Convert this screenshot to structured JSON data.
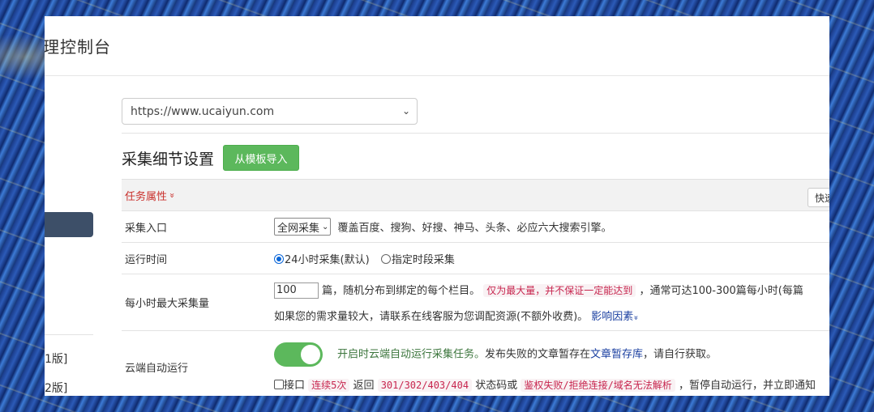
{
  "header": {
    "title": "理控制台"
  },
  "sidebar": {
    "items": [
      {
        "label": "1版]"
      },
      {
        "label": "2版]"
      }
    ]
  },
  "site_select": {
    "value": "https://www.ucaiyun.com"
  },
  "section": {
    "title": "采集细节设置",
    "import_button": "从模板导入"
  },
  "table": {
    "header_label": "任务属性",
    "header_caret": "»",
    "quick_button": "快速",
    "entry": {
      "label": "采集入口",
      "select_value": "全网采集",
      "desc": "覆盖百度、搜狗、好搜、神马、头条、必应六大搜索引擎。"
    },
    "runtime": {
      "label": "运行时间",
      "option1": "24小时采集(默认)",
      "option2": "指定时段采集"
    },
    "max_per_hour": {
      "label": "每小时最大采集量",
      "input_value": "100",
      "text1": "篇，随机分布到绑定的每个栏目。",
      "highlight": "仅为最大量，并不保证一定能达到",
      "text2": "，通常可达100-300篇每小时(每篇",
      "line2": "如果您的需求量较大，请联系在线客服为您调配资源(不额外收费)。",
      "link": "影响因素",
      "link_caret": "»"
    },
    "cloud_run": {
      "label": "云端自动运行",
      "toggle_text": "开启时云端自动运行采集任务。",
      "text_mid": "发布失败的文章暂存在",
      "link": "文章暂存库",
      "text_end": "，请自行获取。",
      "chk_label": "接口",
      "code1": "连续5次",
      "text_a": "返回",
      "code2": "301/302/403/404",
      "text_b": "状态码或",
      "code3": "鉴权失败/拒绝连接/域名无法解析",
      "text_c": "，暂停自动运行，并立即通知"
    }
  }
}
